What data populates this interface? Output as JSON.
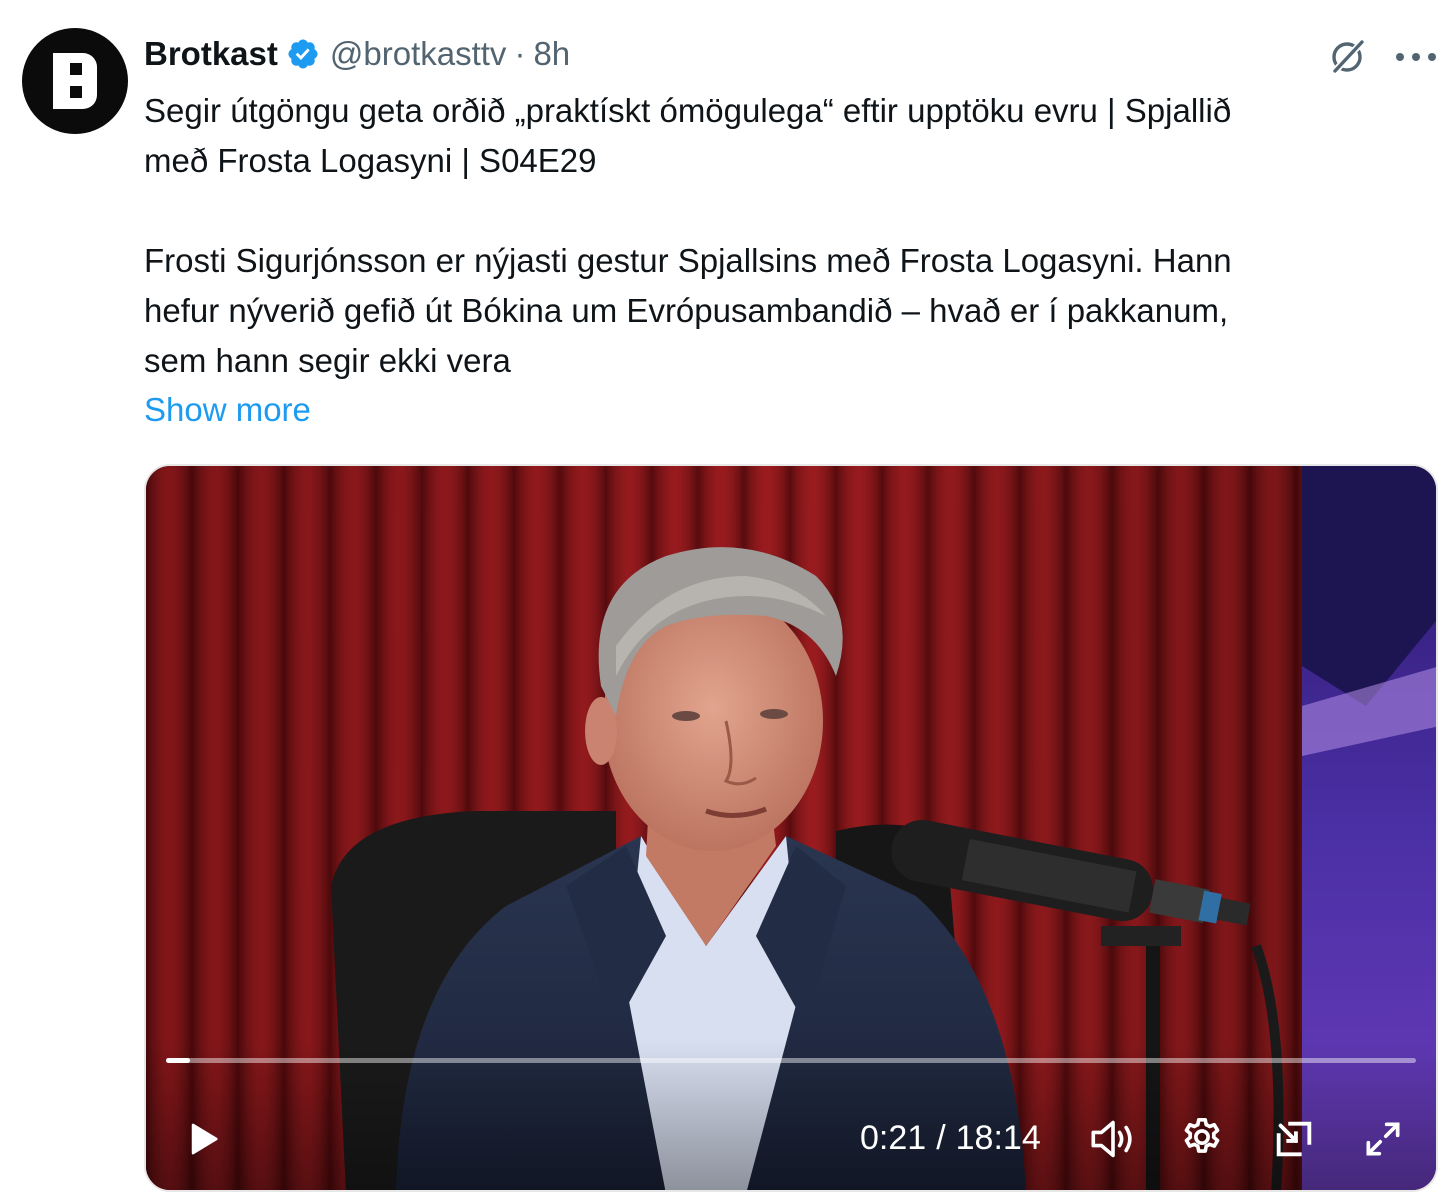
{
  "tweet": {
    "author_name": "Brotkast",
    "handle": "@brotkasttv",
    "separator": "·",
    "time": "8h",
    "text_lines": [
      "Segir útgöngu geta orðið „praktískt ómögulega“ eftir upptöku evru | Spjallið",
      "með Frosta Logasyni | S04E29",
      "",
      "Frosti Sigurjónsson er nýjasti gestur Spjallsins með Frosta Logasyni. Hann",
      "hefur nýverið gefið út Bókina um Evrópusambandið – hvað er í pakkanum,",
      "sem hann segir ekki vera"
    ],
    "show_more": "Show more"
  },
  "icons": {
    "verified": "verified-badge-icon",
    "grok": "grok-icon",
    "more": "more-options-icon",
    "play": "play-icon",
    "volume": "volume-icon",
    "settings": "gear-icon",
    "pip": "picture-in-picture-icon",
    "fullscreen": "fullscreen-icon"
  },
  "video": {
    "current_time": "0:21",
    "time_separator": "/",
    "duration": "18:14",
    "progress_fraction": 0.019
  },
  "colors": {
    "link": "#1d9bf0",
    "verified": "#1d9bf0",
    "secondary_text": "#536471",
    "primary_text": "#0f1419"
  }
}
